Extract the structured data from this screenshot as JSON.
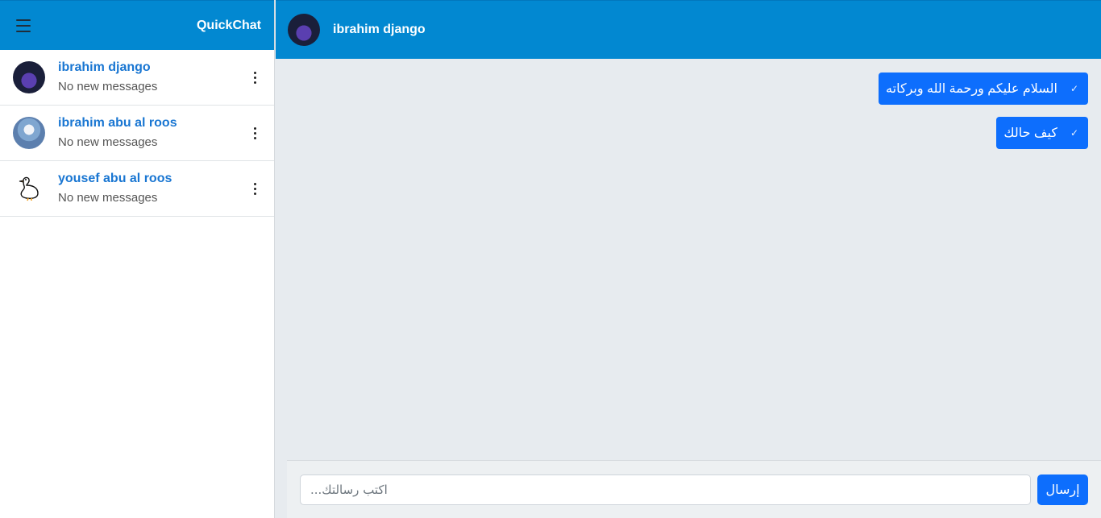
{
  "sidebar": {
    "brand": "QuickChat",
    "contacts": [
      {
        "name": "ibrahim django",
        "status": "No new messages",
        "avatar": "dark-photo-avatar"
      },
      {
        "name": "ibrahim abu al roos",
        "status": "No new messages",
        "avatar": "light-photo-avatar"
      },
      {
        "name": "yousef abu al roos",
        "status": "No new messages",
        "avatar": "duck-avatar"
      }
    ]
  },
  "chat": {
    "title": "ibrahim django",
    "messages": [
      {
        "text": "السلام عليكم ورحمة الله وبركاته",
        "status_icon": "✓"
      },
      {
        "text": "كيف حالك",
        "status_icon": "✓"
      }
    ],
    "composer": {
      "placeholder": "اكتب رسالتك...",
      "send_label": "إرسال"
    }
  },
  "colors": {
    "primary_header": "#0288d1",
    "bubble": "#0d6efd",
    "contact_name": "#1976d2"
  }
}
